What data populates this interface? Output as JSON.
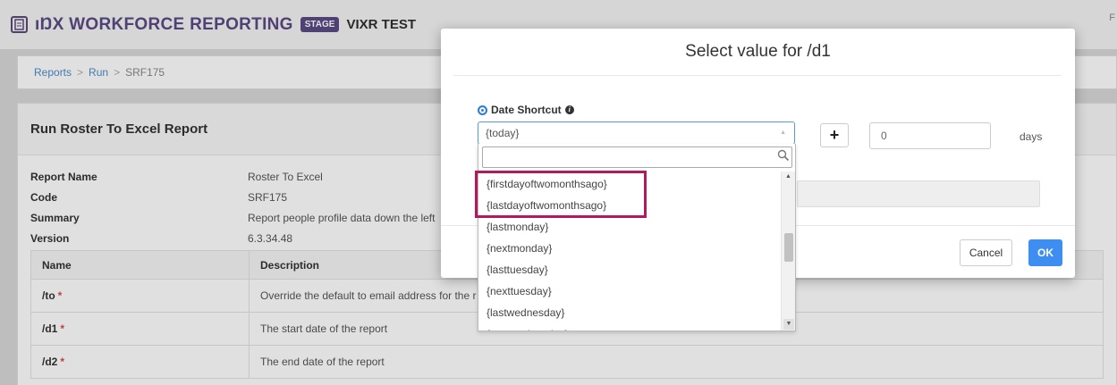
{
  "app": {
    "logo_icon": "document-logo-icon",
    "brand": "ıŊX WORKFORCE REPORTING",
    "stage_badge": "STAGE",
    "env_name": "VIXR TEST",
    "topbar_right": "F"
  },
  "breadcrumb": {
    "items": [
      "Reports",
      "Run",
      "SRF175"
    ],
    "separator": ">"
  },
  "panel": {
    "title": "Run Roster To Excel Report",
    "details": [
      {
        "key": "Report Name",
        "value": "Roster To Excel"
      },
      {
        "key": "Code",
        "value": "SRF175"
      },
      {
        "key": "Summary",
        "value": "Report people profile data down the left"
      },
      {
        "key": "Version",
        "value": "6.3.34.48"
      }
    ],
    "table": {
      "headers": [
        "Name",
        "Description"
      ],
      "rows": [
        {
          "name": "/to",
          "required": "*",
          "description": "Override the default to email address for the r"
        },
        {
          "name": "/d1",
          "required": "*",
          "description": "The start date of the report"
        },
        {
          "name": "/d2",
          "required": "*",
          "description": "The end date of the report"
        }
      ]
    }
  },
  "modal": {
    "title": "Select value for /d1",
    "radio_label": "Date Shortcut",
    "info_icon": "info-icon",
    "selected_value": "{today}",
    "plus_label": "+",
    "days_value": "0",
    "days_label": "days",
    "cancel_label": "Cancel",
    "ok_label": "OK"
  },
  "dropdown": {
    "search_value": "",
    "options": [
      "{firstdayoftwomonthsago}",
      "{lastdayoftwomonthsago}",
      "{lastmonday}",
      "{nextmonday}",
      "{lasttuesday}",
      "{nexttuesday}",
      "{lastwednesday}",
      "{nextwednesday}"
    ],
    "highlighted": [
      "{firstdayoftwomonthsago}",
      "{lastdayoftwomonthsago}"
    ],
    "highlight_color": "#b5185e"
  },
  "colors": {
    "brand": "#5b4a83",
    "link": "#4a8ec8",
    "primary_button": "#3d8ef0",
    "required": "#e04848"
  }
}
